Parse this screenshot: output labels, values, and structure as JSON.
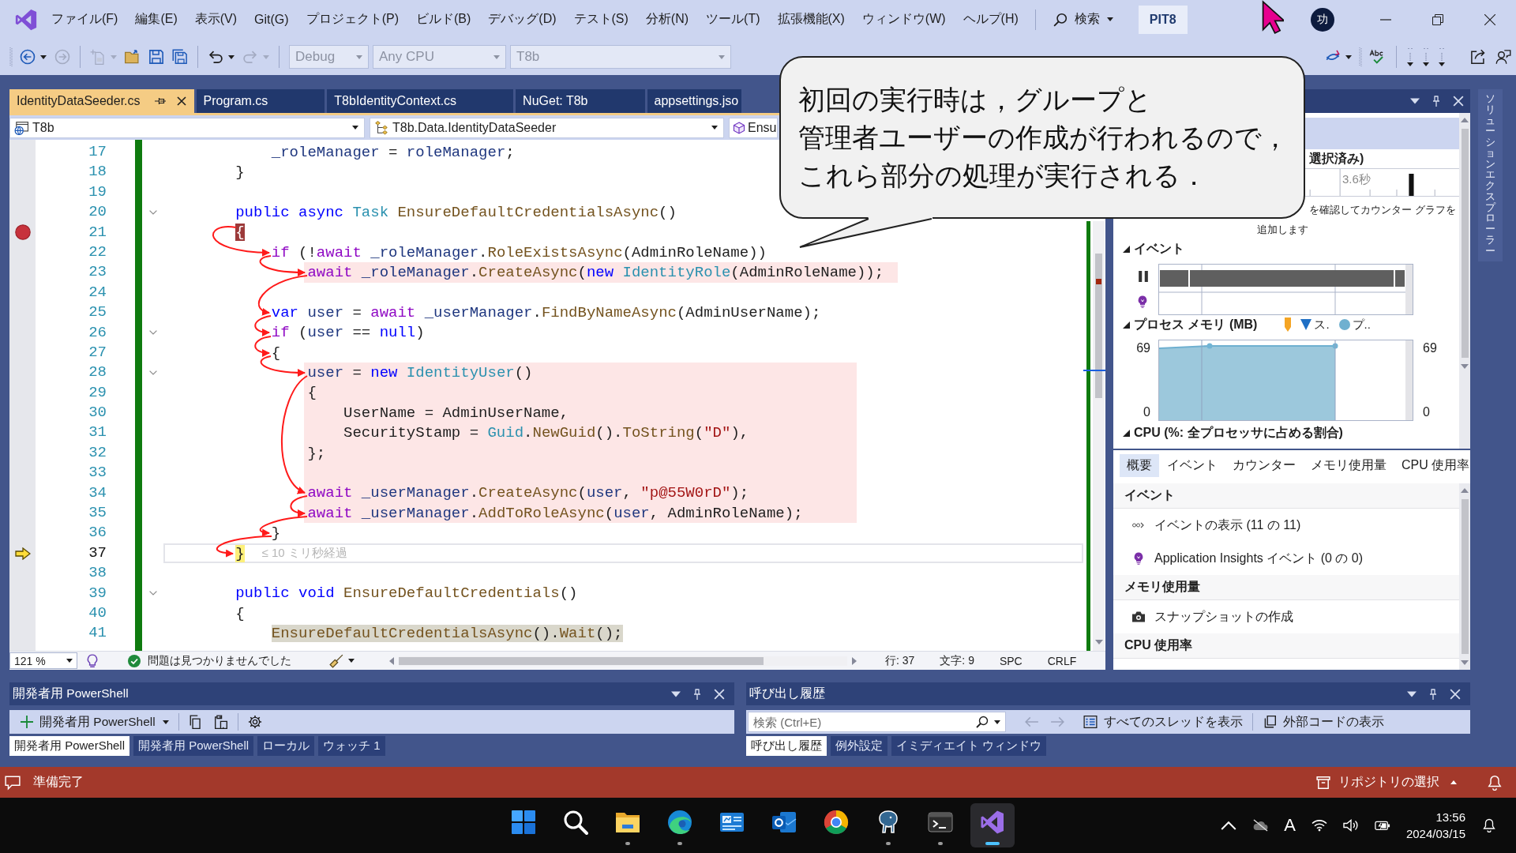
{
  "menu_bar": {
    "items": [
      "ファイル(F)",
      "編集(E)",
      "表示(V)",
      "Git(G)",
      "プロジェクト(P)",
      "ビルド(B)",
      "デバッグ(D)",
      "テスト(S)",
      "分析(N)",
      "ツール(T)",
      "拡張機能(X)",
      "ウィンドウ(W)",
      "ヘルプ(H)"
    ],
    "search": {
      "label": "検索"
    },
    "solution": "PIT8",
    "avatar": "功"
  },
  "toolbar": {
    "button_groups": [
      [
        {
          "kind": "back",
          "disabled": false
        },
        {
          "kind": "forward",
          "disabled": true
        }
      ],
      [
        {
          "kind": "new-item",
          "disabled": true
        },
        {
          "kind": "open",
          "disabled": false
        },
        {
          "kind": "save",
          "disabled": false
        },
        {
          "kind": "save-all",
          "disabled": false
        }
      ],
      [
        {
          "kind": "undo",
          "disabled": false
        },
        {
          "kind": "redo",
          "disabled": true
        }
      ]
    ],
    "dropdowns": [
      {
        "value": "Debug",
        "disabled": true
      },
      {
        "value": "Any CPU",
        "disabled": true
      },
      {
        "value": "T8b",
        "disabled": true
      }
    ]
  },
  "document_tabs": [
    {
      "label": "IdentityDataSeeder.cs",
      "selected": true
    },
    {
      "label": "Program.cs",
      "selected": false
    },
    {
      "label": "T8bIdentityContext.cs",
      "selected": false
    },
    {
      "label": "NuGet: T8b",
      "selected": false
    },
    {
      "label": "appsettings.jso",
      "selected": false
    }
  ],
  "navigation_bar": {
    "project": "T8b",
    "type": "T8b.Data.IdentityDataSeeder",
    "member": "Ensu"
  },
  "editor": {
    "lines": [
      {
        "number": "17",
        "kind": "code",
        "foldable": false,
        "highlighted": false,
        "tokens": [
          {
            "kind": "var",
            "text": "            _roleManager"
          },
          {
            "kind": "plain",
            "text": " = "
          },
          {
            "kind": "var",
            "text": "roleManager"
          },
          {
            "kind": "plain",
            "text": ";"
          }
        ]
      },
      {
        "number": "18",
        "kind": "code",
        "foldable": false,
        "highlighted": false,
        "tokens": [
          {
            "kind": "plain",
            "text": "        }"
          }
        ]
      },
      {
        "number": "19",
        "kind": "code",
        "foldable": false,
        "highlighted": false
      },
      {
        "number": "20",
        "kind": "code",
        "foldable": true,
        "highlighted": false,
        "tokens": [
          {
            "kind": "kw",
            "text": "        public async "
          },
          {
            "kind": "type",
            "text": "Task "
          },
          {
            "kind": "method",
            "text": "EnsureDefaultCredentialsAsync"
          },
          {
            "kind": "plain",
            "text": "()"
          }
        ]
      },
      {
        "number": "21",
        "kind": "breakpoint",
        "foldable": false,
        "highlighted": false,
        "tokens": [
          {
            "kind": "plain",
            "text": "        {"
          }
        ]
      },
      {
        "number": "22",
        "kind": "code",
        "foldable": false,
        "highlighted": false,
        "tokens": [
          {
            "kind": "ctl",
            "text": "            if"
          },
          {
            "kind": "plain",
            "text": " (!"
          },
          {
            "kind": "ctl",
            "text": "await "
          },
          {
            "kind": "var",
            "text": "_roleManager"
          },
          {
            "kind": "plain",
            "text": "."
          },
          {
            "kind": "method",
            "text": "RoleExistsAsync"
          },
          {
            "kind": "plain",
            "text": "(AdminRoleName))"
          }
        ]
      },
      {
        "number": "23",
        "kind": "code",
        "foldable": false,
        "highlighted": true,
        "tokens": [
          {
            "kind": "ctl",
            "text": "                await "
          },
          {
            "kind": "var",
            "text": "_roleManager"
          },
          {
            "kind": "plain",
            "text": "."
          },
          {
            "kind": "method",
            "text": "CreateAsync"
          },
          {
            "kind": "plain",
            "text": "("
          },
          {
            "kind": "kw",
            "text": "new "
          },
          {
            "kind": "type",
            "text": "IdentityRole"
          },
          {
            "kind": "plain",
            "text": "(AdminRoleName));"
          }
        ]
      },
      {
        "number": "24",
        "kind": "code",
        "foldable": false,
        "highlighted": false
      },
      {
        "number": "25",
        "kind": "code",
        "foldable": false,
        "highlighted": false,
        "tokens": [
          {
            "kind": "kw",
            "text": "            var "
          },
          {
            "kind": "var",
            "text": "user"
          },
          {
            "kind": "plain",
            "text": " = "
          },
          {
            "kind": "ctl",
            "text": "await "
          },
          {
            "kind": "var",
            "text": "_userManager"
          },
          {
            "kind": "plain",
            "text": "."
          },
          {
            "kind": "method",
            "text": "FindByNameAsync"
          },
          {
            "kind": "plain",
            "text": "(AdminUserName);"
          }
        ]
      },
      {
        "number": "26",
        "kind": "code",
        "foldable": true,
        "highlighted": false,
        "tokens": [
          {
            "kind": "ctl",
            "text": "            if"
          },
          {
            "kind": "plain",
            "text": " ("
          },
          {
            "kind": "var",
            "text": "user"
          },
          {
            "kind": "plain",
            "text": " == "
          },
          {
            "kind": "kw",
            "text": "null"
          },
          {
            "kind": "plain",
            "text": ")"
          }
        ]
      },
      {
        "number": "27",
        "kind": "code",
        "foldable": false,
        "highlighted": false,
        "tokens": [
          {
            "kind": "plain",
            "text": "            {"
          }
        ]
      },
      {
        "number": "28",
        "kind": "code",
        "foldable": true,
        "highlighted": true,
        "tokens": [
          {
            "kind": "var",
            "text": "                user"
          },
          {
            "kind": "plain",
            "text": " = "
          },
          {
            "kind": "kw",
            "text": "new "
          },
          {
            "kind": "type",
            "text": "IdentityUser"
          },
          {
            "kind": "plain",
            "text": "()"
          }
        ]
      },
      {
        "number": "29",
        "kind": "code",
        "foldable": false,
        "highlighted": true,
        "tokens": [
          {
            "kind": "plain",
            "text": "                {"
          }
        ]
      },
      {
        "number": "30",
        "kind": "code",
        "foldable": false,
        "highlighted": true,
        "tokens": [
          {
            "kind": "plain",
            "text": "                    UserName = AdminUserName,"
          }
        ]
      },
      {
        "number": "31",
        "kind": "code",
        "foldable": false,
        "highlighted": true,
        "tokens": [
          {
            "kind": "plain",
            "text": "                    SecurityStamp = "
          },
          {
            "kind": "type",
            "text": "Guid"
          },
          {
            "kind": "plain",
            "text": "."
          },
          {
            "kind": "method",
            "text": "NewGuid"
          },
          {
            "kind": "plain",
            "text": "()."
          },
          {
            "kind": "method",
            "text": "ToString"
          },
          {
            "kind": "plain",
            "text": "("
          },
          {
            "kind": "str",
            "text": "\"D\""
          },
          {
            "kind": "plain",
            "text": "),"
          }
        ]
      },
      {
        "number": "32",
        "kind": "code",
        "foldable": false,
        "highlighted": true,
        "tokens": [
          {
            "kind": "plain",
            "text": "                };"
          }
        ]
      },
      {
        "number": "33",
        "kind": "code",
        "foldable": false,
        "highlighted": true
      },
      {
        "number": "34",
        "kind": "code",
        "foldable": false,
        "highlighted": true,
        "tokens": [
          {
            "kind": "ctl",
            "text": "                await "
          },
          {
            "kind": "var",
            "text": "_userManager"
          },
          {
            "kind": "plain",
            "text": "."
          },
          {
            "kind": "method",
            "text": "CreateAsync"
          },
          {
            "kind": "plain",
            "text": "("
          },
          {
            "kind": "var",
            "text": "user"
          },
          {
            "kind": "plain",
            "text": ", "
          },
          {
            "kind": "str",
            "text": "\"p@55W0rD\""
          },
          {
            "kind": "plain",
            "text": ");"
          }
        ]
      },
      {
        "number": "35",
        "kind": "code",
        "foldable": false,
        "highlighted": true,
        "tokens": [
          {
            "kind": "ctl",
            "text": "                await "
          },
          {
            "kind": "var",
            "text": "_userManager"
          },
          {
            "kind": "plain",
            "text": "."
          },
          {
            "kind": "method",
            "text": "AddToRoleAsync"
          },
          {
            "kind": "plain",
            "text": "("
          },
          {
            "kind": "var",
            "text": "user"
          },
          {
            "kind": "plain",
            "text": ", AdminRoleName);"
          }
        ]
      },
      {
        "number": "36",
        "kind": "code",
        "foldable": false,
        "highlighted": false,
        "tokens": [
          {
            "kind": "plain",
            "text": "            }"
          }
        ]
      },
      {
        "number": "37",
        "kind": "current",
        "foldable": false,
        "highlighted": false,
        "tokens": [
          {
            "kind": "plain",
            "text": "        }"
          }
        ],
        "tip": "≤ 10 ミリ秒経過"
      },
      {
        "number": "38",
        "kind": "code",
        "foldable": false,
        "highlighted": false
      },
      {
        "number": "39",
        "kind": "code",
        "foldable": true,
        "highlighted": false,
        "tokens": [
          {
            "kind": "kw",
            "text": "        public void "
          },
          {
            "kind": "method",
            "text": "EnsureDefaultCredentials"
          },
          {
            "kind": "plain",
            "text": "()"
          }
        ]
      },
      {
        "number": "40",
        "kind": "code",
        "foldable": false,
        "highlighted": false,
        "tokens": [
          {
            "kind": "plain",
            "text": "        {"
          }
        ]
      },
      {
        "number": "41",
        "kind": "caller",
        "foldable": false,
        "highlighted": false,
        "tokens": [
          {
            "kind": "method",
            "text": "            EnsureDefaultCredentialsAsync"
          },
          {
            "kind": "plain",
            "text": "()."
          },
          {
            "kind": "method",
            "text": "Wait"
          },
          {
            "kind": "plain",
            "text": "();"
          }
        ]
      }
    ]
  },
  "editor_status": {
    "zoom": "121 %",
    "issues": "問題は見つかりませんでした",
    "line": "行: 37",
    "column": "文字: 9",
    "whitespace": "SPC",
    "line_ending": "CRLF"
  },
  "callout": {
    "lines": [
      "初回の実行時は，グループと",
      "管理者ユーザーの作成が行われるので，",
      "これら部分の処理が実行される．"
    ]
  },
  "diagnostic_tools": {
    "selection_label": "選択済み)",
    "ruler_label": "3.6秒",
    "hint_lines": [
      "を確認してカウンター グラフを",
      "追加します"
    ],
    "sections": [
      {
        "kind": "events",
        "title": "イベント",
        "expanded": true
      },
      {
        "kind": "memory",
        "title": "プロセス メモリ (MB)",
        "expanded": true,
        "legend": [
          {
            "kind": "flag",
            "color": "#f5a524"
          },
          {
            "kind": "triangle",
            "label": "ス.",
            "color": "#1f6fc5"
          },
          {
            "kind": "dot",
            "label": "プ..",
            "color": "#6fb0d0"
          }
        ],
        "left_axis_labels": [
          "69",
          "0"
        ],
        "right_axis_labels": [
          "69",
          "0"
        ]
      },
      {
        "kind": "cpu",
        "title": "CPU (%: 全プロセッサに占める割合)",
        "expanded": true
      }
    ],
    "tabs": [
      {
        "label": "概要",
        "selected": true
      },
      {
        "label": "イベント",
        "selected": false
      },
      {
        "label": "カウンター",
        "selected": false
      },
      {
        "label": "メモリ使用量",
        "selected": false
      },
      {
        "label": "CPU 使用率",
        "selected": false
      }
    ],
    "summary": [
      {
        "kind": "header",
        "label": "イベント"
      },
      {
        "kind": "events",
        "label": "イベントの表示 (11 の 11)"
      },
      {
        "kind": "insights",
        "label": "Application Insights イベント (0 の 0)"
      },
      {
        "kind": "header",
        "label": "メモリ使用量"
      },
      {
        "kind": "snapshot",
        "label": "スナップショットの作成"
      },
      {
        "kind": "header",
        "label": "CPU 使用率"
      }
    ]
  },
  "solution_explorer_tab": {
    "label": "ソリューションエクスプローラー"
  },
  "terminal_panel": {
    "title": "開発者用 PowerShell",
    "profile": "開発者用 PowerShell",
    "tabs": [
      {
        "label": "開発者用 PowerShell",
        "selected": true
      },
      {
        "label": "開発者用 PowerShell",
        "selected": false
      },
      {
        "label": "ローカル",
        "selected": false
      },
      {
        "label": "ウォッチ 1",
        "selected": false
      }
    ]
  },
  "call_stack_panel": {
    "title": "呼び出し履歴",
    "search": {
      "placeholder": "検索 (Ctrl+E)"
    },
    "actions": [
      {
        "kind": "threads",
        "label": "すべてのスレッドを表示"
      },
      {
        "kind": "external",
        "label": "外部コードの表示"
      }
    ],
    "tabs": [
      {
        "label": "呼び出し履歴",
        "selected": true
      },
      {
        "label": "例外設定",
        "selected": false
      },
      {
        "label": "イミディエイト ウィンドウ",
        "selected": false
      }
    ]
  },
  "status_bar": {
    "message": "準備完了",
    "repository": "リポジトリの選択"
  },
  "taskbar": {
    "apps": [
      {
        "kind": "start",
        "running": false,
        "selected": false
      },
      {
        "kind": "search",
        "running": false,
        "selected": false
      },
      {
        "kind": "folder",
        "running": true,
        "selected": false
      },
      {
        "kind": "swirl",
        "running": true,
        "selected": false
      },
      {
        "kind": "dashboard",
        "running": false,
        "selected": false
      },
      {
        "kind": "mail",
        "running": false,
        "selected": false
      },
      {
        "kind": "round",
        "running": false,
        "selected": false
      },
      {
        "kind": "elephant",
        "running": true,
        "selected": false
      },
      {
        "kind": "terminal",
        "running": true,
        "selected": false
      },
      {
        "kind": "ide",
        "running": true,
        "selected": true
      }
    ],
    "input_mode": "A",
    "time": "13:56",
    "date": "2024/03/15"
  }
}
